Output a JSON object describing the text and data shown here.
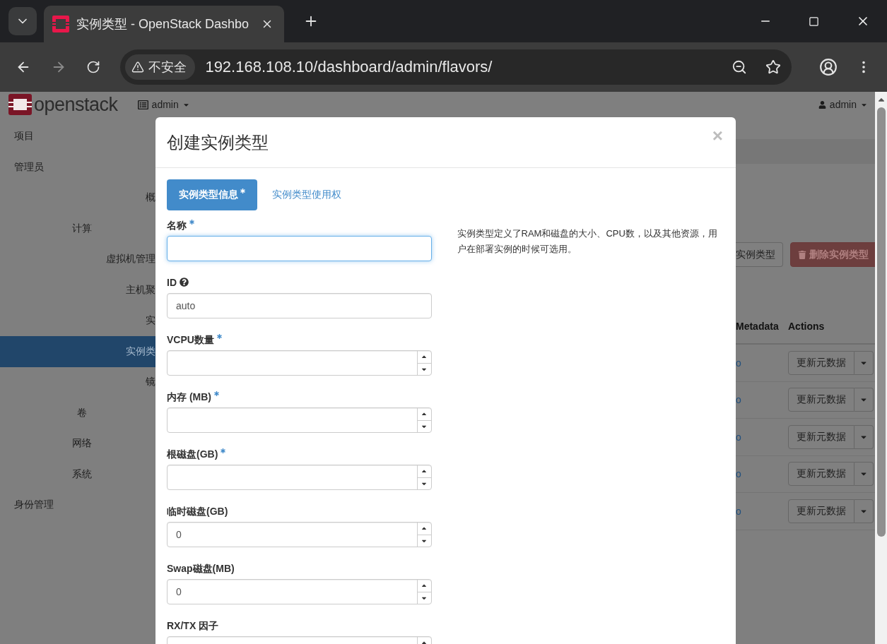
{
  "browser": {
    "tab_title": "实例类型 - OpenStack Dashbo",
    "security": "不安全",
    "url": "192.168.108.10/dashboard/admin/flavors/",
    "forward_enabled": false
  },
  "header": {
    "logo": "openstack",
    "project_menu": "admin",
    "user_menu": "admin"
  },
  "sidebar": {
    "items": [
      {
        "label": "项目",
        "kind": "dashboard",
        "selected": false
      },
      {
        "label": "管理员",
        "kind": "dashboard",
        "selected": false,
        "children": [
          {
            "label": "概",
            "kind": "panel",
            "selected": false
          },
          {
            "label": "计算",
            "kind": "group",
            "selected": false,
            "children": [
              {
                "label": "虚拟机管理",
                "kind": "panel",
                "selected": false
              },
              {
                "label": "主机聚",
                "kind": "panel",
                "selected": false
              },
              {
                "label": "实",
                "kind": "panel",
                "selected": false
              },
              {
                "label": "实例类",
                "kind": "panel",
                "selected": true
              },
              {
                "label": "镜",
                "kind": "panel",
                "selected": false
              }
            ]
          },
          {
            "label": "卷",
            "kind": "group",
            "selected": false
          },
          {
            "label": "网络",
            "kind": "group",
            "selected": false
          },
          {
            "label": "系统",
            "kind": "group",
            "selected": false
          }
        ]
      },
      {
        "label": "身份管理",
        "kind": "dashboard",
        "selected": false
      }
    ]
  },
  "actions": [
    {
      "label": "实例类型",
      "kind": "default"
    },
    {
      "label": "删除实例类型",
      "kind": "danger"
    }
  ],
  "table": {
    "columns": [
      "Metadata",
      "Actions"
    ],
    "rows": [
      {
        "metadata": "o",
        "action": "更新元数据"
      },
      {
        "metadata": "o",
        "action": "更新元数据"
      },
      {
        "metadata": "o",
        "action": "更新元数据"
      },
      {
        "metadata": "o",
        "action": "更新元数据"
      },
      {
        "metadata": "o",
        "action": "更新元数据"
      }
    ]
  },
  "modal": {
    "title": "创建实例类型",
    "close": "×",
    "tabs": [
      {
        "label": "实例类型信息",
        "required": true,
        "selected": true
      },
      {
        "label": "实例类型使用权",
        "required": false,
        "selected": false
      }
    ],
    "fields": [
      {
        "label": "名称",
        "kind": "text",
        "required": true,
        "help": false,
        "focused": true
      },
      {
        "label": "ID",
        "kind": "text",
        "required": false,
        "help": true,
        "focused": false,
        "value": "auto"
      },
      {
        "label": "VCPU数量",
        "kind": "number",
        "required": true,
        "help": false,
        "focused": false
      },
      {
        "label": "内存 (MB)",
        "kind": "number",
        "required": true,
        "help": false,
        "focused": false
      },
      {
        "label": "根磁盘(GB)",
        "kind": "number",
        "required": true,
        "help": false,
        "focused": false
      },
      {
        "label": "临时磁盘(GB)",
        "kind": "number",
        "required": false,
        "help": false,
        "focused": false,
        "value": "0"
      },
      {
        "label": "Swap磁盘(MB)",
        "kind": "number",
        "required": false,
        "help": false,
        "focused": false,
        "value": "0"
      },
      {
        "label": "RX/TX 因子",
        "kind": "number",
        "required": false,
        "help": false,
        "focused": false
      }
    ],
    "description": "实例类型定义了RAM和磁盘的大小、CPU数，以及其他资源，用户在部署实例的时候可选用。"
  }
}
